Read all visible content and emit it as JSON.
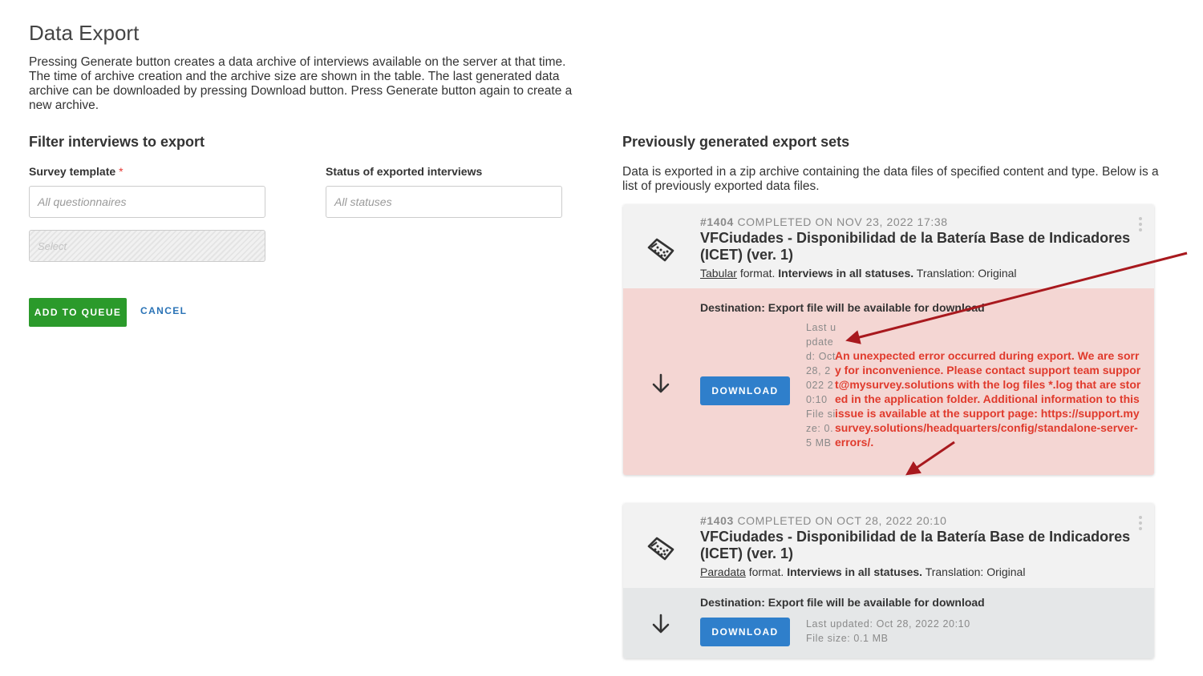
{
  "page": {
    "title": "Data Export",
    "intro": "Pressing Generate button creates a data archive of interviews available on the server at that time. The time of archive creation and the archive size are shown in the table. The last generated data archive can be downloaded by pressing Download button. Press Generate button again to create a new archive."
  },
  "filter": {
    "title": "Filter interviews to export",
    "survey_label": "Survey template",
    "required_mark": "*",
    "survey_placeholder": "All questionnaires",
    "status_label": "Status of exported interviews",
    "status_placeholder": "All statuses",
    "select_placeholder": "Select",
    "add_to_queue": "ADD TO QUEUE",
    "cancel": "CANCEL"
  },
  "previous": {
    "title": "Previously generated export sets",
    "description": "Data is exported in a zip archive containing the data files of specified content and type. Below is a list of previously exported data files."
  },
  "exports": [
    {
      "id": "#1404",
      "status": "COMPLETED ON NOV 23, 2022 17:38",
      "title": "VFCiudades - Disponibilidad de la Batería Base de Indicadores (ICET) (ver. 1)",
      "format": "Tabular",
      "format_suffix": "format.",
      "statuses": "Interviews in all statuses.",
      "translation": "Translation: Original",
      "destination": "Destination: Export file will be available for download",
      "download": "DOWNLOAD",
      "updated": "Last updated: Oct 28, 2022 20:10",
      "size": "File size: 0.5 MB",
      "error": "An unexpected error occurred during export. We are sorry for inconvenience. Please contact support team support@mysurvey.solutions with the log files *.log that are stored in the application folder. Additional information to this issue is available at the support page: https://support.mysurvey.solutions/headquarters/config/standalone-server-errors/.",
      "colors": {
        "body": "#f4d6d3",
        "error": "#e03a2c"
      }
    },
    {
      "id": "#1403",
      "status": "COMPLETED ON OCT 28, 2022 20:10",
      "title": "VFCiudades - Disponibilidad de la Batería Base de Indicadores (ICET) (ver. 1)",
      "format": "Paradata",
      "format_suffix": "format.",
      "statuses": "Interviews in all statuses.",
      "translation": "Translation: Original",
      "destination": "Destination: Export file will be available for download",
      "download": "DOWNLOAD",
      "updated": "Last updated: Oct 28, 2022 20:10",
      "size": "File size: 0.1 MB",
      "colors": {
        "body": "#e5e7e8"
      }
    }
  ],
  "icons": {
    "questionnaire": "questionnaire-icon",
    "download_arrow": "arrow-down-icon",
    "menu": "kebab-menu-icon"
  },
  "colors": {
    "primary_green": "#2b9a2b",
    "primary_blue": "#2f7fcb",
    "link_blue": "#2a73b6",
    "annotation_red": "#a8191e"
  }
}
